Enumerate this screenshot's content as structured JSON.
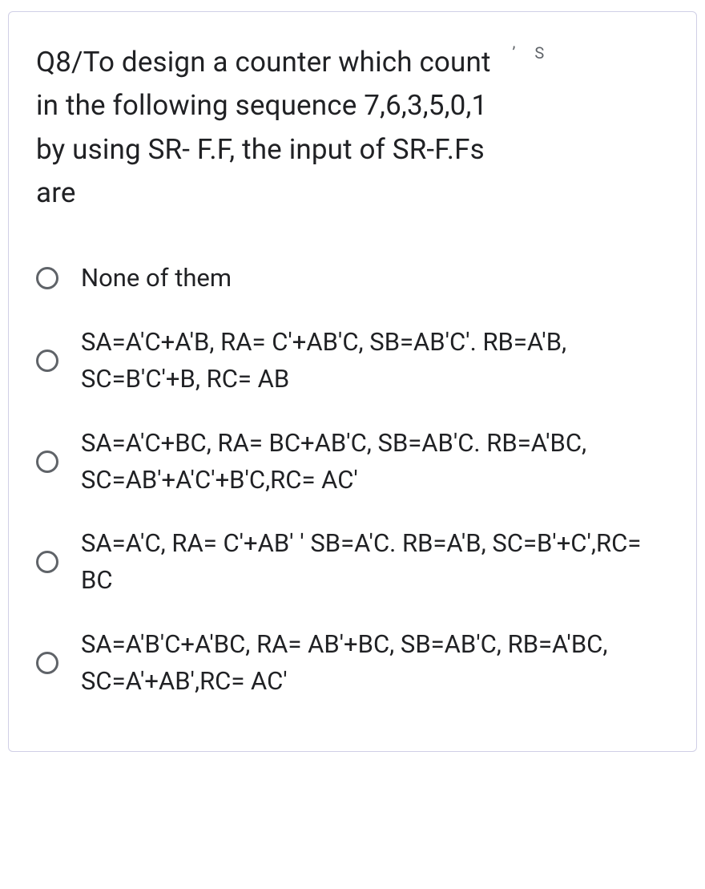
{
  "question": {
    "line1_part1": "Q8/To design a counter which count",
    "line1_meta1": "’",
    "line1_meta2": "S",
    "line2": "in the following sequence 7,6,3,5,0,1",
    "line3": " by using SR- F.F, the input of SR-F.Fs",
    "line4": "are"
  },
  "options": [
    {
      "name": "option-1",
      "text": "None of them"
    },
    {
      "name": "option-2",
      "text": "SA=A'C+A'B, RA= C'+AB'C, SB=AB'C'. RB=A'B, SC=B'C'+B, RC= AB"
    },
    {
      "name": "option-3",
      "text": "SA=A'C+BC, RA= BC+AB'C, SB=AB'C. RB=A'BC, SC=AB'+A'C'+B'C,RC= AC'"
    },
    {
      "name": "option-4",
      "text": "SA=A'C, RA= C'+AB' ' SB=A'C. RB=A'B, SC=B'+C',RC= BC"
    },
    {
      "name": "option-5",
      "text": "SA=A'B'C+A'BC, RA= AB'+BC, SB=AB'C, RB=A'BC, SC=A'+AB',RC= AC'"
    }
  ]
}
